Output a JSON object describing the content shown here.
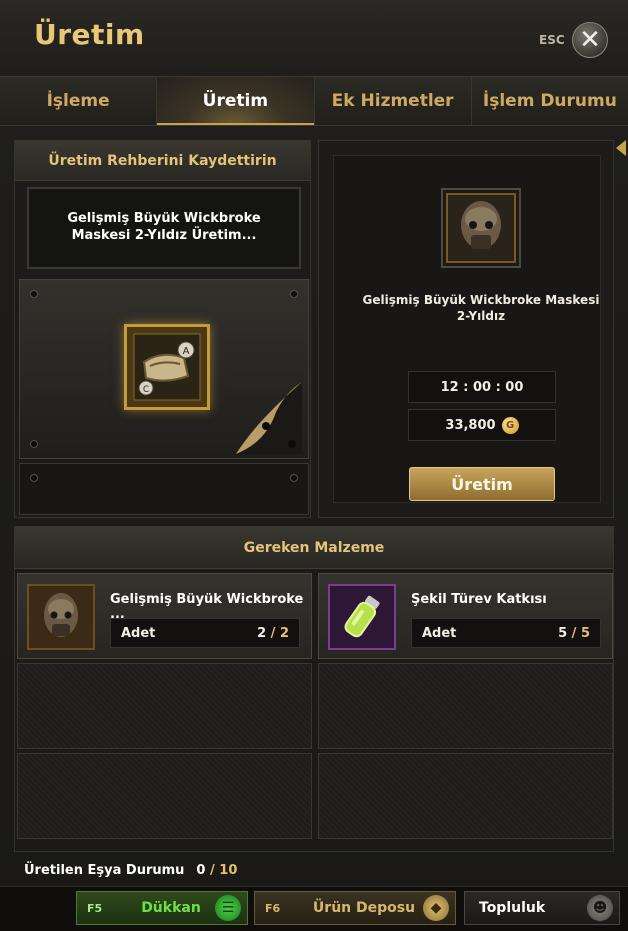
{
  "window": {
    "title": "Üretim",
    "esc_label": "ESC"
  },
  "tabs": [
    {
      "label": "İşleme",
      "active": false
    },
    {
      "label": "Üretim",
      "active": true
    },
    {
      "label": "Ek Hizmetler",
      "active": false
    },
    {
      "label": "İşlem Durumu",
      "active": false
    }
  ],
  "recipe_panel": {
    "header": "Üretim Rehberini Kaydettirin",
    "recipe_name": "Gelişmiş Büyük Wickbroke Maskesi 2-Yıldız Üretim..."
  },
  "result_panel": {
    "item_name": "Gelişmiş Büyük Wickbroke Maskesi 2-Yıldız",
    "time": "12 : 00 : 00",
    "cost": "33,800",
    "currency_icon": "G",
    "craft_button": "Üretim"
  },
  "materials": {
    "header": "Gereken Malzeme",
    "items": [
      {
        "name": "Gelişmiş Büyük Wickbroke ...",
        "qty_label": "Adet",
        "have": "2",
        "need": "2",
        "icon": "mask-icon"
      },
      {
        "name": "Şekil Türev Katkısı",
        "qty_label": "Adet",
        "have": "5",
        "need": "5",
        "icon": "vial-icon"
      }
    ]
  },
  "produced": {
    "label": "Üretilen Eşya Durumu",
    "current": "0",
    "max": "10"
  },
  "bottom_bar": {
    "shop": {
      "key": "F5",
      "label": "Dükkan"
    },
    "depot": {
      "key": "F6",
      "label": "Ürün Deposu"
    },
    "community": {
      "label": "Topluluk"
    }
  },
  "colors": {
    "accent_gold": "#e9c777",
    "shop_green": "#6fe04a",
    "rare_purple": "#7c3c94"
  }
}
